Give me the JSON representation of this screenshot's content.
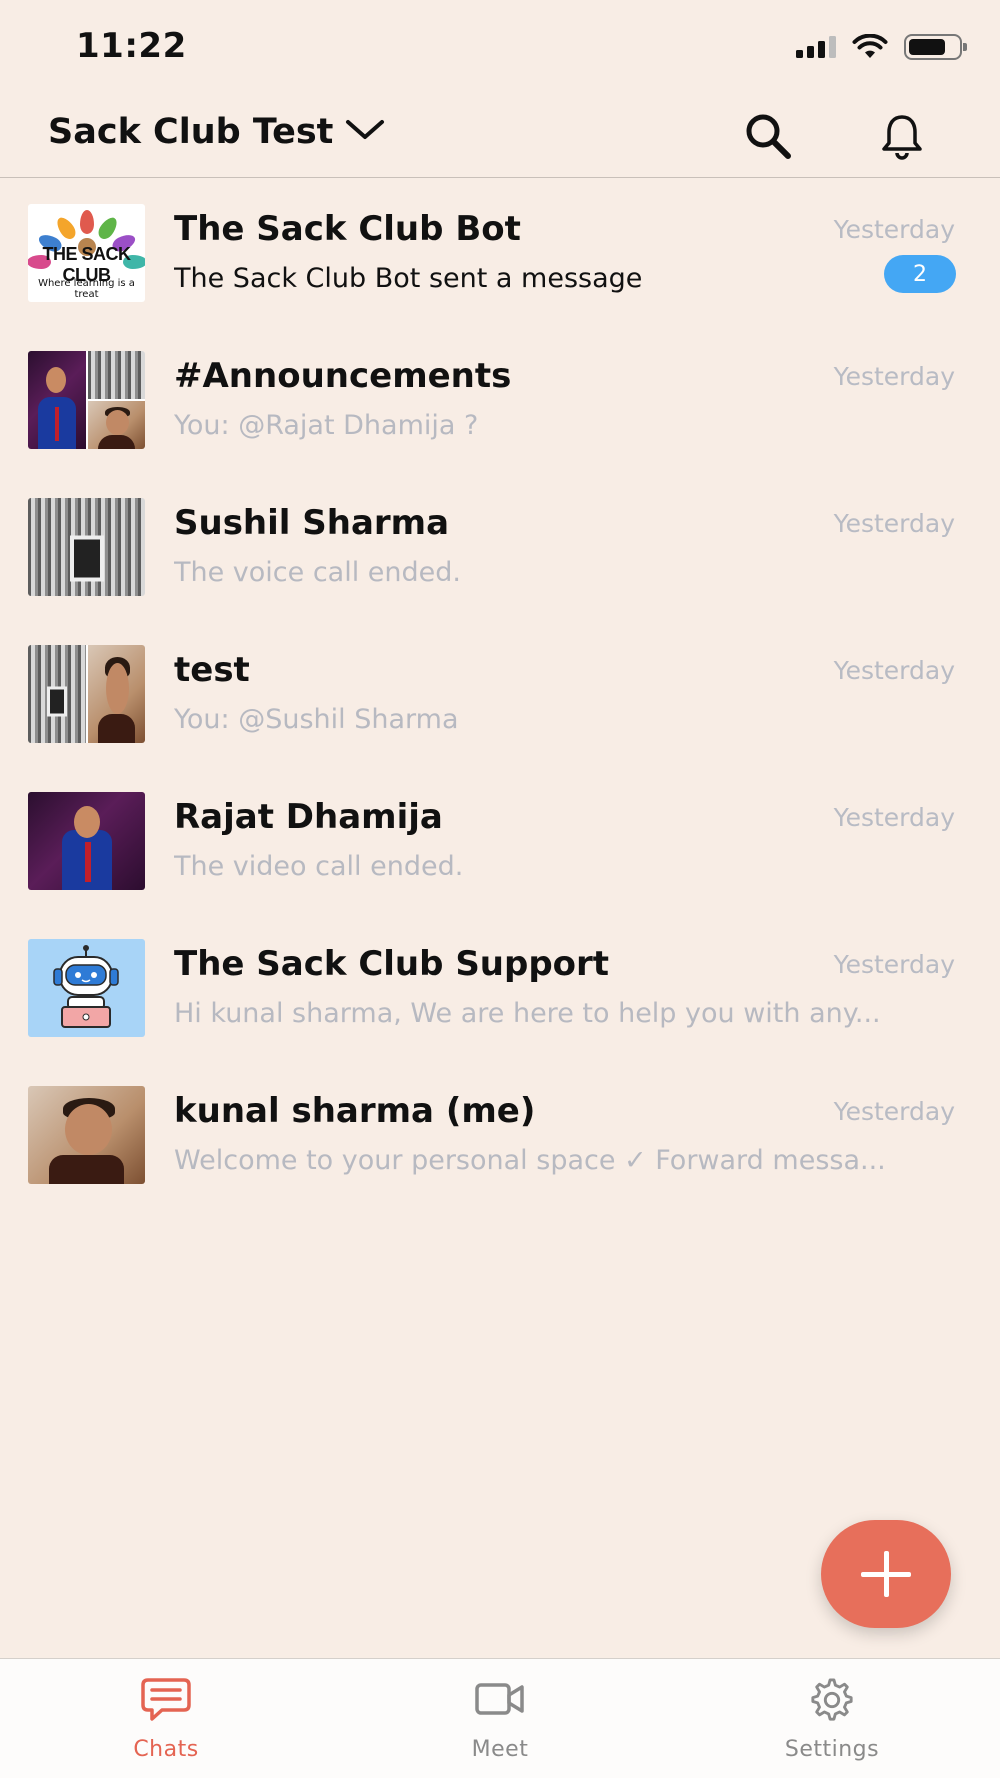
{
  "status_bar": {
    "time": "11:22"
  },
  "header": {
    "workspace_title": "Sack Club Test",
    "icons": {
      "dropdown": "chevron-down-icon",
      "search": "search-icon",
      "notifications": "bell-icon"
    }
  },
  "chats": [
    {
      "name": "The Sack Club Bot",
      "time": "Yesterday",
      "preview": "The Sack Club Bot sent a message",
      "unread": "2",
      "avatar": "logo",
      "avatar_text": "THE SACK CLUB",
      "avatar_subtext": "Where learning is a treat"
    },
    {
      "name": "#Announcements",
      "time": "Yesterday",
      "preview": " You: @Rajat Dhamija ?",
      "avatar": "group-collage"
    },
    {
      "name": "Sushil Sharma",
      "time": "Yesterday",
      "preview": "The voice call ended.",
      "avatar": "building"
    },
    {
      "name": "test",
      "time": "Yesterday",
      "preview": " You: @Sushil Sharma",
      "avatar": "split"
    },
    {
      "name": "Rajat Dhamija",
      "time": "Yesterday",
      "preview": "The video call ended.",
      "avatar": "suit"
    },
    {
      "name": "The Sack Club Support",
      "time": "Yesterday",
      "preview": "Hi kunal sharma, We are here to help you with any...",
      "avatar": "robot"
    },
    {
      "name": "kunal sharma (me)",
      "time": "Yesterday",
      "preview": "Welcome to your personal space ✓ Forward messa...",
      "avatar": "face"
    }
  ],
  "fab": {
    "icon": "plus-icon"
  },
  "tabs": [
    {
      "label": "Chats",
      "icon": "chat-icon",
      "active": true
    },
    {
      "label": "Meet",
      "icon": "video-icon",
      "active": false
    },
    {
      "label": "Settings",
      "icon": "gear-icon",
      "active": false
    }
  ],
  "colors": {
    "background": "#f8ede5",
    "accent": "#e76f5b",
    "badge": "#44a7f4",
    "muted_text": "#b7b9c1"
  }
}
